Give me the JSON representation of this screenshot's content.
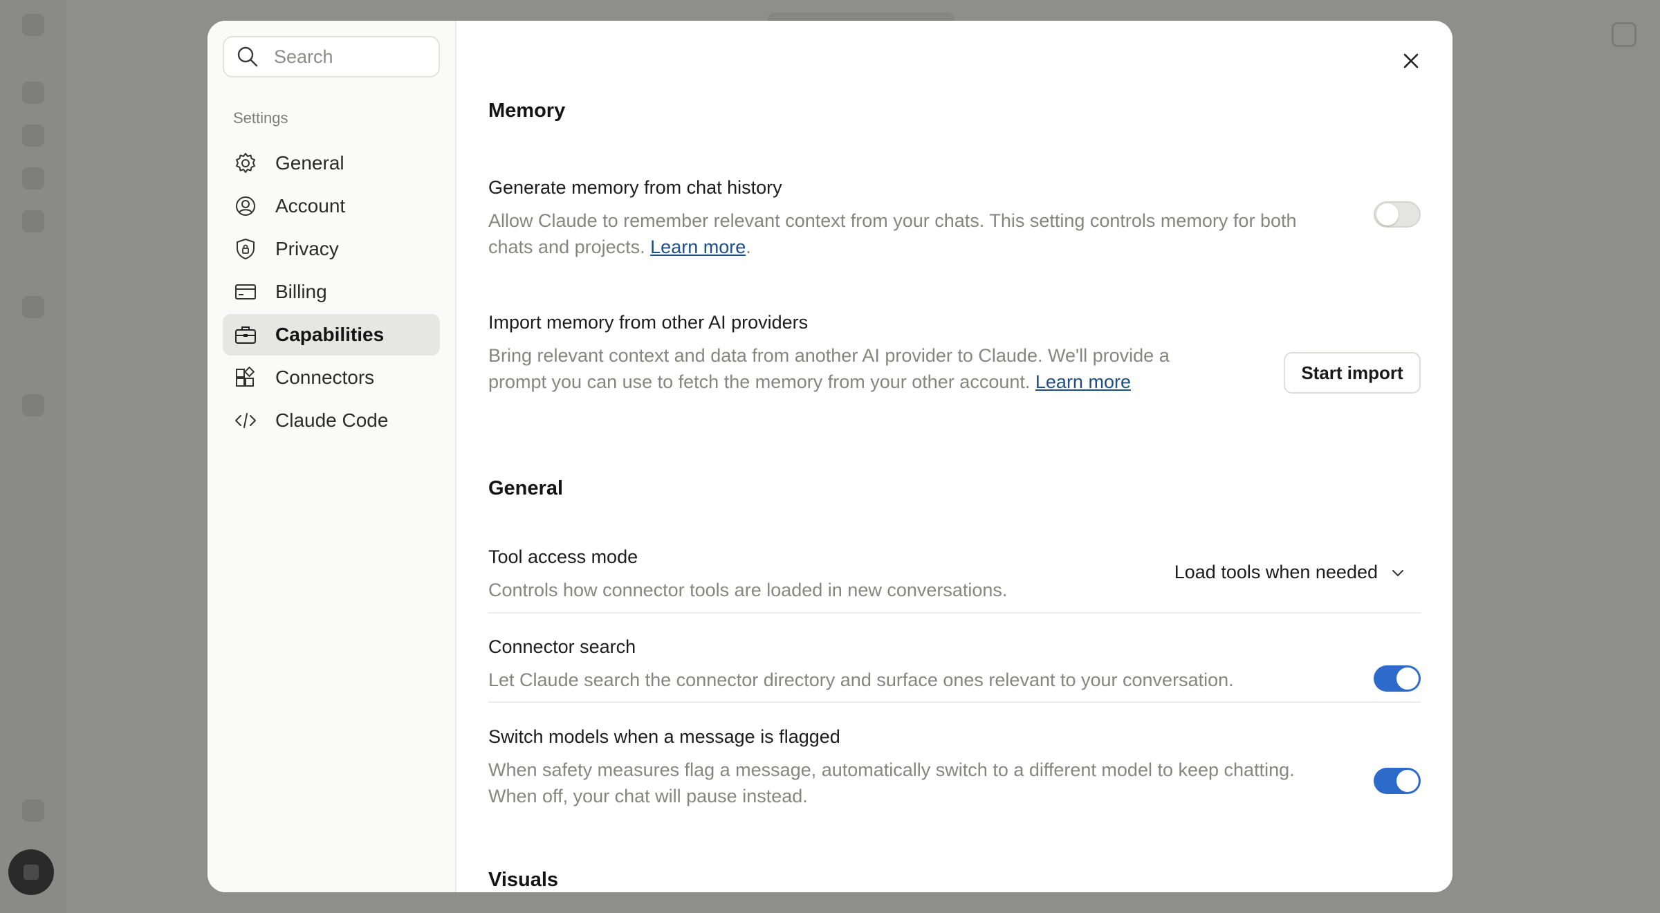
{
  "settings_nav": {
    "search_placeholder": "Search",
    "heading": "Settings",
    "items": [
      {
        "label": "General",
        "icon": "gear-icon"
      },
      {
        "label": "Account",
        "icon": "user-circle-icon"
      },
      {
        "label": "Privacy",
        "icon": "shield-icon"
      },
      {
        "label": "Billing",
        "icon": "credit-card-icon"
      },
      {
        "label": "Capabilities",
        "icon": "briefcase-icon",
        "active": true
      },
      {
        "label": "Connectors",
        "icon": "connectors-icon"
      },
      {
        "label": "Claude Code",
        "icon": "code-icon"
      }
    ]
  },
  "memory": {
    "title": "Memory",
    "generate": {
      "title": "Generate memory from chat history",
      "desc": "Allow Claude to remember relevant context from your chats. This setting controls memory for both chats and projects.",
      "link": "Learn more",
      "enabled": false
    },
    "import": {
      "title": "Import memory from other AI providers",
      "desc": "Bring relevant context and data from another AI provider to Claude. We'll provide a prompt you can use to fetch the memory from your other account.",
      "link": "Learn more",
      "button": "Start import"
    }
  },
  "general": {
    "title": "General",
    "tool_access": {
      "title": "Tool access mode",
      "desc": "Controls how connector tools are loaded in new conversations.",
      "value": "Load tools when needed"
    },
    "connector_search": {
      "title": "Connector search",
      "desc": "Let Claude search the connector directory and surface ones relevant to your conversation.",
      "enabled": true
    },
    "switch_models": {
      "title": "Switch models when a message is flagged",
      "desc": "When safety measures flag a message, automatically switch to a different model to keep chatting. When off, your chat will pause instead.",
      "enabled": true
    }
  },
  "visuals": {
    "title": "Visuals"
  },
  "colors": {
    "toggle_on": "#2c6bc9",
    "link": "#1d4e89",
    "overlay": "#8e8e8c"
  }
}
